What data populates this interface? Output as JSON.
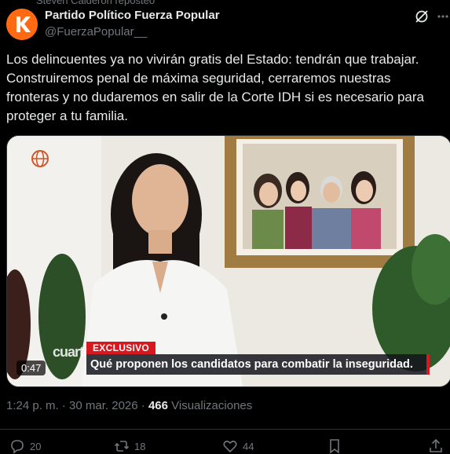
{
  "repost_line": "Steven Calderón reposteó",
  "author": {
    "name": "Partido Político Fuerza Popular",
    "handle": "@FuerzaPopular__",
    "avatar_letter": "K",
    "avatar_color": "#ff6a13"
  },
  "tweet": {
    "text": "Los delincuentes ya no vivirán gratis del Estado: tendrán que trabajar. Construiremos penal de máxima seguridad, cerraremos nuestras fronteras y no dudaremos en salir de la Corte IDH si es necesario para proteger a tu familia."
  },
  "video": {
    "badge": "EXCLUSIVO",
    "headline": "Qué proponen los candidatos para combatir la inseguridad.",
    "duration": "0:47",
    "watermark": "cuarto poder",
    "accent": "#d8171f"
  },
  "meta": {
    "time": "1:24 p. m. · 30 mar. 2026 ·",
    "views": "466",
    "views_label": "Visualizaciones"
  },
  "actions": {
    "replies": "20",
    "reposts": "18",
    "likes": "44"
  }
}
